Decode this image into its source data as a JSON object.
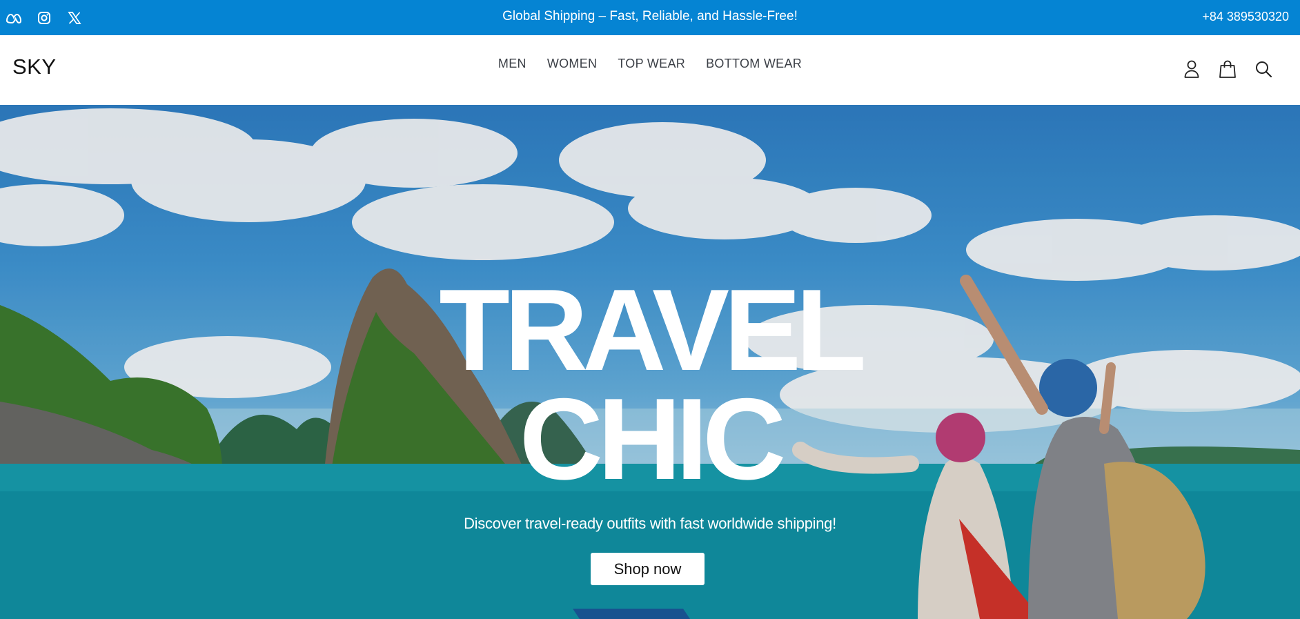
{
  "topbar": {
    "social_icons": [
      "meta-icon",
      "instagram-icon",
      "x-icon"
    ],
    "announcement": "Global Shipping – Fast, Reliable, and Hassle-Free!",
    "phone": "+84 389530320",
    "bg_color": "#0584d3"
  },
  "header": {
    "logo": "SKY",
    "nav": [
      {
        "label": "MEN"
      },
      {
        "label": "WOMEN"
      },
      {
        "label": "TOP WEAR"
      },
      {
        "label": "BOTTOM WEAR"
      }
    ],
    "icons": [
      "user-icon",
      "shopping-bag-icon",
      "search-icon"
    ]
  },
  "hero": {
    "title_line1": "TRAVEL",
    "title_line2": "CHIC",
    "subtitle": "Discover travel-ready outfits with fast worldwide shipping!",
    "cta_label": "Shop now"
  }
}
